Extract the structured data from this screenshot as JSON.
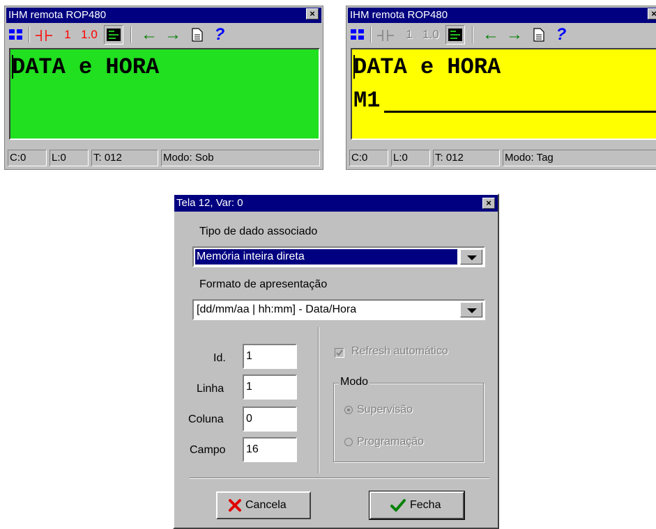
{
  "win1": {
    "title": "IHM remota ROP480",
    "close": "×",
    "toolbar": {
      "one": "1",
      "one_zero": "1.0",
      "left_arrow": "←",
      "right_arrow": "→",
      "help": "?"
    },
    "lcd_line1": "DATA e HORA",
    "lcd_color": "#20e020",
    "status": {
      "c": "C:0",
      "l": "L:0",
      "t": "T: 012",
      "mode": "Modo: Sob"
    }
  },
  "win2": {
    "title": "IHM remota ROP480",
    "close": "×",
    "toolbar": {
      "one": "1",
      "one_zero": "1.0",
      "left_arrow": "←",
      "right_arrow": "→",
      "help": "?"
    },
    "lcd_line1": "DATA e HORA",
    "lcd_line2": "M1",
    "lcd_color": "#ffff00",
    "status": {
      "c": "C:0",
      "l": "L:0",
      "t": "T: 012",
      "mode": "Modo: Tag"
    }
  },
  "dialog": {
    "title": "Tela 12, Var: 0",
    "close": "×",
    "tipo_label": "Tipo de dado associado",
    "tipo_value": "Memória inteira direta",
    "formato_label": "Formato de apresentação",
    "formato_value": "[dd/mm/aa | hh:mm] - Data/Hora",
    "id_label": "Id.",
    "id_value": "1",
    "linha_label": "Linha",
    "linha_value": "1",
    "coluna_label": "Coluna",
    "coluna_value": "0",
    "campo_label": "Campo",
    "campo_value": "16",
    "refresh_label": "Refresh automático",
    "modo_label": "Modo",
    "supervisao_label": "Supervisão",
    "programacao_label": "Programação",
    "cancel_label": "Cancela",
    "close_btn_label": "Fecha"
  },
  "colors": {
    "titlebar": "#000080",
    "chrome": "#c0c0c0",
    "red_tool": "#ff0000",
    "green_arrow": "#008000"
  },
  "icons": [
    "grid-icon",
    "contact-icon",
    "display-mode-icon",
    "arrow-left-icon",
    "arrow-right-icon",
    "page-icon",
    "help-icon",
    "x-icon",
    "check-icon"
  ]
}
